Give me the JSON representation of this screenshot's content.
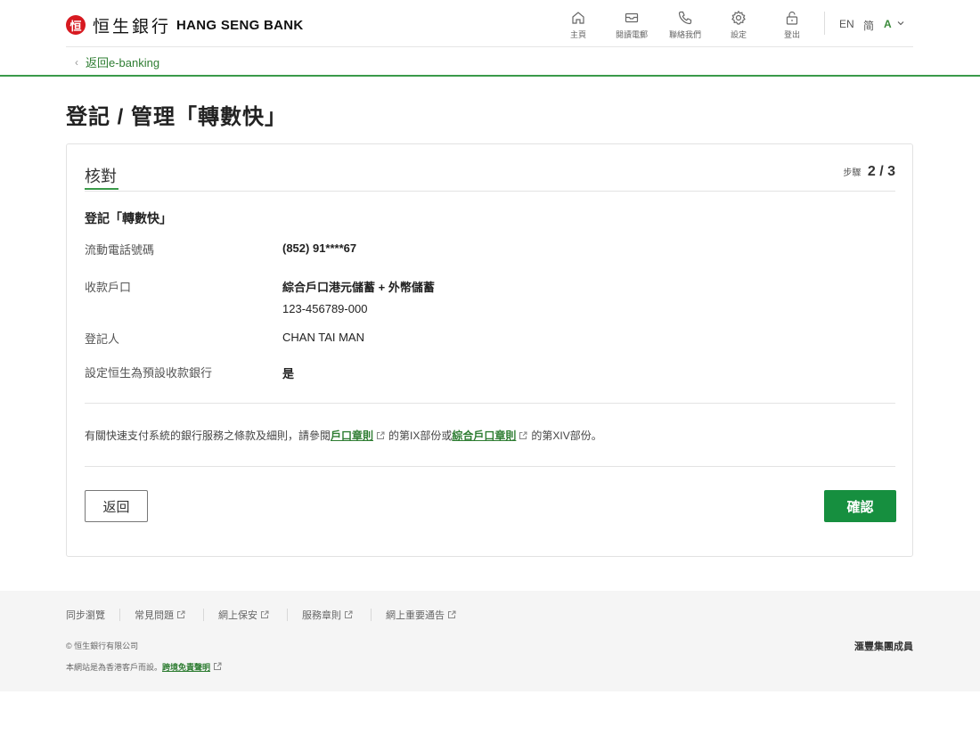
{
  "header": {
    "logo_mark": "恒",
    "logo_cn": "恒生銀行",
    "logo_en": "HANG SENG BANK",
    "nav": [
      {
        "label": "主頁",
        "icon": "home-icon"
      },
      {
        "label": "閱讀電郵",
        "icon": "mail-icon"
      },
      {
        "label": "聯絡我們",
        "icon": "phone-icon"
      },
      {
        "label": "設定",
        "icon": "gear-icon"
      },
      {
        "label": "登出",
        "icon": "unlock-icon"
      }
    ],
    "lang_en": "EN",
    "lang_sc": "简",
    "font_size": "A",
    "back_link": "返回e-banking"
  },
  "page_title": "登記 / 管理「轉數快」",
  "card": {
    "title": "核對",
    "step_label": "步驟",
    "step_value": "2 / 3",
    "section_title": "登記「轉數快」",
    "rows": [
      {
        "label": "流動電話號碼",
        "value": "(852) 91****67"
      },
      {
        "label": "收款戶口",
        "value": "綜合戶口港元儲蓄 + 外幣儲蓄",
        "sub": "123-456789-000"
      },
      {
        "label": "登記人",
        "value": "CHAN TAI MAN"
      },
      {
        "label": "設定恒生為預設收款銀行",
        "value": "是"
      }
    ],
    "terms": {
      "part1": "有關快速支付系統的銀行服務之條款及細則，請參閱",
      "link1": "戶口章則",
      "part2": "的第IX部份或",
      "link2": "綜合戶口章則",
      "part3": "的第XIV部份。"
    },
    "back_button": "返回",
    "confirm_button": "確認"
  },
  "footer": {
    "links": [
      "同步瀏覽",
      "常見問題",
      "網上保安",
      "服務章則",
      "網上重要通告"
    ],
    "copyright": "© 恒生銀行有限公司",
    "note": "本網站是為香港客戶而設。",
    "note_link": "跨境免責聲明",
    "member": "滙豐集團成員"
  },
  "colors": {
    "brand_green": "#168f3f",
    "link_green": "#2e7d32",
    "logo_red": "#d71920"
  }
}
